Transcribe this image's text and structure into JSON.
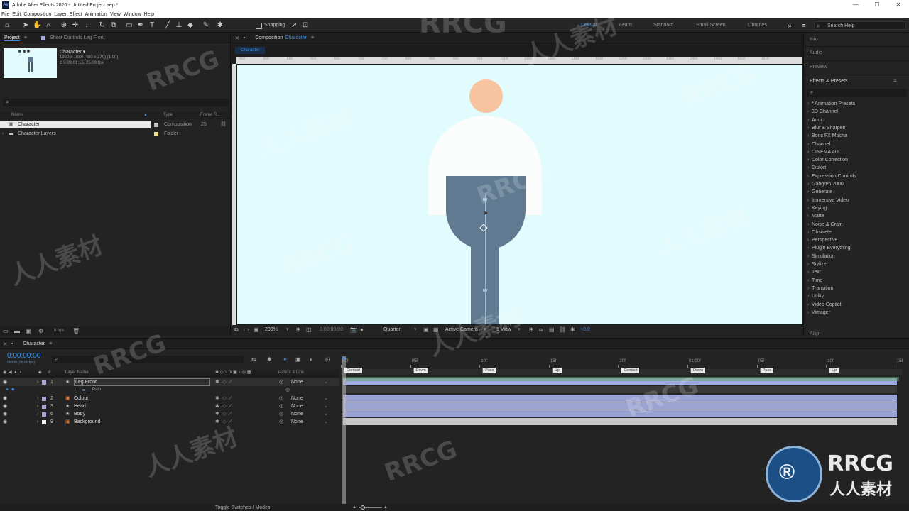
{
  "window": {
    "title": "Adobe After Effects 2020 - Untitled Project.aep *",
    "app_icon": "Ae"
  },
  "menu": [
    "File",
    "Edit",
    "Composition",
    "Layer",
    "Effect",
    "Animation",
    "View",
    "Window",
    "Help"
  ],
  "toolbar": {
    "snapping_label": "Snapping",
    "workspaces": [
      "Default",
      "Learn",
      "Standard",
      "Small Screen",
      "Libraries"
    ],
    "search_placeholder": "Search Help"
  },
  "project_panel": {
    "tab_project": "Project",
    "tab_effect_controls": "Effect Controls Leg Front",
    "comp_name": "Character",
    "comp_info_1": "1920 x 1080  (480 x 270) (1.00)",
    "comp_info_2": "Δ 0:00:01:15, 25.00 fps",
    "columns": {
      "name": "Name",
      "type": "Type",
      "frame_rate": "Frame R..."
    },
    "items": [
      {
        "name": "Character",
        "type": "Composition",
        "frame_rate": "25"
      },
      {
        "name": "Character Layers",
        "type": "Folder",
        "frame_rate": ""
      }
    ],
    "bpc": "8 bpc"
  },
  "composition": {
    "tab_prefix": "Composition",
    "tab_name": "Character",
    "breadcrumb": "Character",
    "ruler_ticks": [
      "450",
      "500",
      "550",
      "600",
      "650",
      "700",
      "750",
      "800",
      "850",
      "900",
      "950",
      "1000",
      "1050",
      "1100",
      "1150",
      "1200",
      "1250",
      "1300",
      "1350",
      "1400",
      "1450",
      "1500",
      "1550"
    ],
    "zoom": "200%",
    "timecode": "0:00:00:00",
    "resolution": "Quarter",
    "camera": "Active Camera",
    "views": "1 View",
    "exposure": "+0.0",
    "colors": {
      "background": "#e2fbfd",
      "head": "#f8c4a0",
      "body": "#fbfdfd",
      "leg": "#5f7a91"
    }
  },
  "right_panel": {
    "info": "Info",
    "audio": "Audio",
    "preview": "Preview",
    "effects_title": "Effects & Presets",
    "effects": [
      "* Animation Presets",
      "3D Channel",
      "Audio",
      "Blur & Sharpen",
      "Boris FX Mocha",
      "Channel",
      "CINEMA 4D",
      "Color Correction",
      "Distort",
      "Expression Controls",
      "Gabgren 2000",
      "Generate",
      "Immersive Video",
      "Keying",
      "Matte",
      "Noise & Grain",
      "Obsolete",
      "Perspective",
      "Plugin Everything",
      "Simulation",
      "Stylize",
      "Text",
      "Time",
      "Transition",
      "Utility",
      "Video Copilot",
      "Vimager"
    ],
    "align": "Align"
  },
  "timeline": {
    "tab_name": "Character",
    "timecode": "0:00:00:00",
    "timecode_sub": "00000 (25.00 fps)",
    "columns": {
      "layer_name": "Layer Name",
      "parent": "Parent & Link"
    },
    "ruler": [
      "00f",
      "05f",
      "10f",
      "15f",
      "20f",
      "01:00f",
      "05f",
      "10f",
      "15f"
    ],
    "markers": [
      "Contact",
      "Down",
      "Pass",
      "Up",
      "Contact",
      "Down",
      "Pass",
      "Up"
    ],
    "layers": [
      {
        "num": "1",
        "name": "Leg Front",
        "parent": "None",
        "color": "#a9a9d8"
      },
      {
        "num": "",
        "name": "Path",
        "parent": "",
        "color": ""
      },
      {
        "num": "2",
        "name": "Colour",
        "parent": "None",
        "color": "#a9a9d8"
      },
      {
        "num": "3",
        "name": "Head",
        "parent": "None",
        "color": "#a9a9d8"
      },
      {
        "num": "6",
        "name": "Body",
        "parent": "None",
        "color": "#a9a9d8"
      },
      {
        "num": "9",
        "name": "Background",
        "parent": "None",
        "color": "#f0f0f0"
      }
    ],
    "toggle_label": "Toggle Switches / Modes"
  },
  "watermark": {
    "latin": "RRCG",
    "cjk": "人人素材"
  }
}
